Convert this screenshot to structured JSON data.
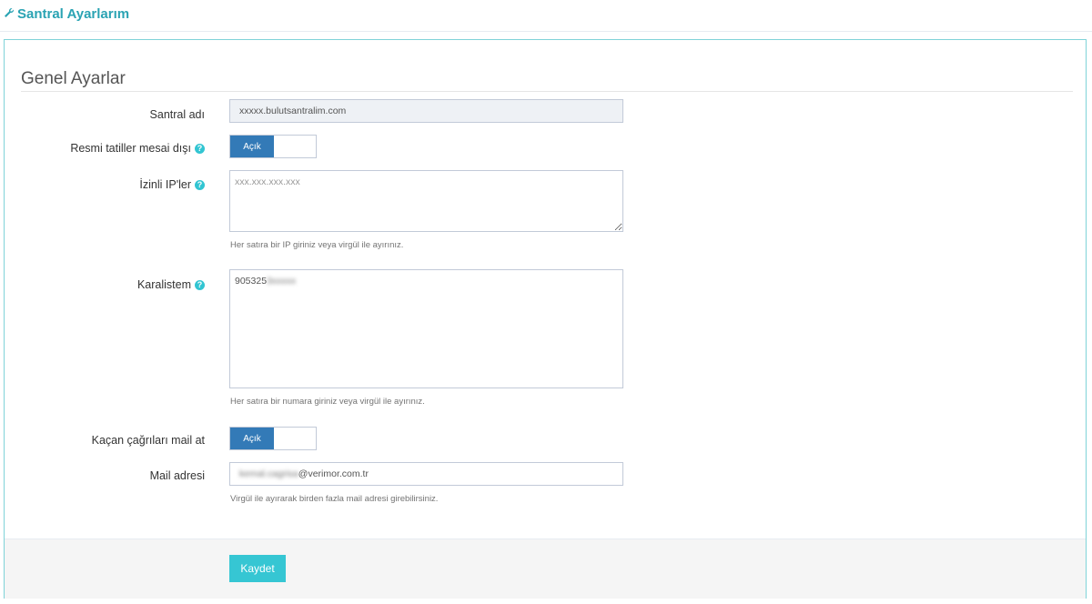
{
  "header": {
    "title": "Santral Ayarlarım",
    "icon": "wrench-icon"
  },
  "section": {
    "title": "Genel Ayarlar"
  },
  "form": {
    "santral_name": {
      "label": "Santral adı",
      "value": "xxxxx.bulutsantralim.com"
    },
    "holiday_toggle": {
      "label": "Resmi tatiller mesai dışı",
      "state_label": "Açık"
    },
    "allowed_ips": {
      "label": "İzinli IP'ler",
      "placeholder": "xxx.xxx.xxx.xxx",
      "help": "Her satıra bir IP giriniz veya virgül ile ayırınız."
    },
    "blacklist": {
      "label": "Karalistem",
      "value_visible": "905325",
      "value_blurred": "3xxxxx",
      "help": "Her satıra bir numara giriniz veya virgül ile ayırınız."
    },
    "missed_calls_toggle": {
      "label": "Kaçan çağrıları mail at",
      "state_label": "Açık"
    },
    "mail": {
      "label": "Mail adresi",
      "value_blurred": "kemal.cagrisa",
      "value_visible": "@verimor.com.tr",
      "help": "Virgül ile ayırarak birden fazla mail adresi girebilirsiniz."
    }
  },
  "actions": {
    "save_label": "Kaydet"
  },
  "colors": {
    "accent": "#36c6d3",
    "toggle_on": "#337ab7",
    "border": "#7fd3d8"
  }
}
